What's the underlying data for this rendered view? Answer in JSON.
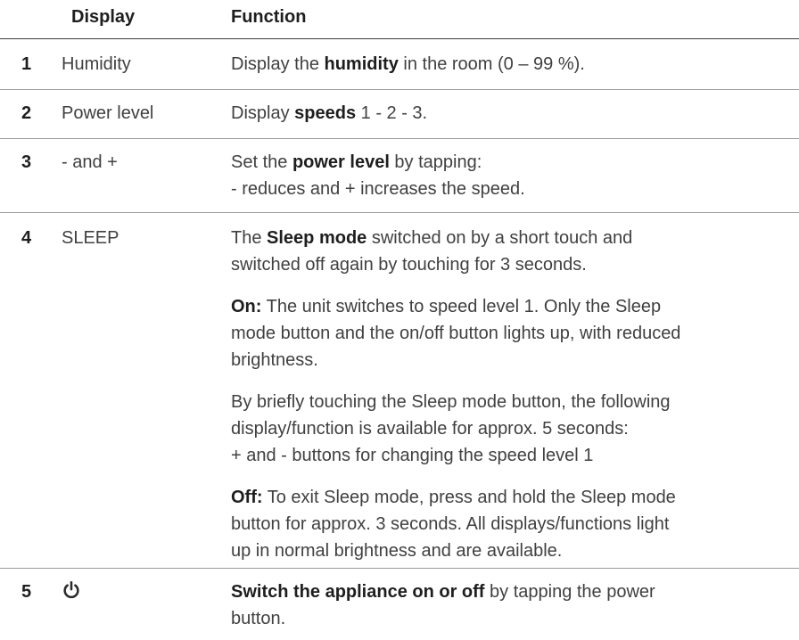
{
  "header": {
    "display": "Display",
    "function": "Function"
  },
  "rows": [
    {
      "num": "1",
      "display": "Humidity",
      "func": [
        {
          "parts": [
            "Display the ",
            "humidity",
            " in the room (0 – 99 %)."
          ]
        }
      ]
    },
    {
      "num": "2",
      "display": "Power level",
      "func": [
        {
          "parts": [
            "Display ",
            "speeds",
            " 1 - 2 - 3."
          ]
        }
      ]
    },
    {
      "num": "3",
      "display": "- and +",
      "func": [
        {
          "parts": [
            "Set the ",
            "power level",
            " by tapping:"
          ]
        },
        {
          "text": "- reduces and + increases the speed."
        }
      ]
    },
    {
      "num": "4",
      "display": "SLEEP",
      "func": [
        {
          "parts": [
            "The ",
            "Sleep mode",
            " switched on by a short touch and"
          ]
        },
        {
          "text": "switched off again by touching for 3 seconds."
        },
        {
          "parts": [
            "",
            "On:",
            " The unit switches to speed level 1. Only the Sleep"
          ]
        },
        {
          "text": "mode button and the on/off button lights up, with reduced"
        },
        {
          "text": "brightness."
        },
        {
          "text": "By briefly touching the Sleep mode button, the following"
        },
        {
          "text": "display/function is available for approx. 5 seconds:"
        },
        {
          "text": "+ and - buttons  for changing the speed level 1"
        },
        {
          "parts": [
            "",
            "Off:",
            " To exit Sleep mode, press and hold the Sleep mode"
          ]
        },
        {
          "text": "button for approx. 3 seconds. All displays/functions light"
        },
        {
          "text": "up in normal brightness and are available."
        }
      ]
    },
    {
      "num": "5",
      "display_icon": "power-icon",
      "func": [
        {
          "parts": [
            "",
            "Switch the appliance on or off",
            " by tapping the power"
          ]
        },
        {
          "text": "button."
        }
      ]
    }
  ]
}
